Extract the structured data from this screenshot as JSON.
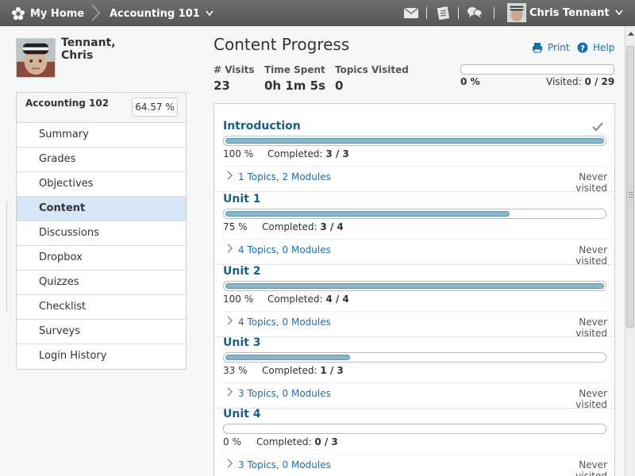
{
  "topbar": {
    "home_label": "My Home",
    "course_label": "Accounting 101",
    "user_name": "Chris Tennant",
    "icons": [
      "mail-icon",
      "notes-icon",
      "chat-icon"
    ]
  },
  "profile": {
    "name_line1": "Tennant,",
    "name_line2": "Chris"
  },
  "nav": {
    "course": "Accounting 102",
    "progress": "64.57 %",
    "items": [
      {
        "label": "Summary"
      },
      {
        "label": "Grades"
      },
      {
        "label": "Objectives"
      },
      {
        "label": "Content"
      },
      {
        "label": "Discussions"
      },
      {
        "label": "Dropbox"
      },
      {
        "label": "Quizzes"
      },
      {
        "label": "Checklist"
      },
      {
        "label": "Surveys"
      },
      {
        "label": "Login History"
      }
    ],
    "active": "Content"
  },
  "main": {
    "title": "Content Progress",
    "print_label": "Print",
    "help_label": "Help",
    "stats": {
      "visits_label": "# Visits",
      "visits_value": "23",
      "time_label": "Time Spent",
      "time_value": "0h 1m 5s",
      "topics_label": "Topics Visited",
      "topics_value": "0"
    },
    "overall": {
      "progress_fraction": 0,
      "pct_label": "0 %",
      "visited_label": "Visited:",
      "visited_value": "0 / 29"
    },
    "completed_label": "Completed:",
    "units": [
      {
        "title": "Introduction",
        "pct": "100 %",
        "progress": 1.0,
        "completed": "3 / 3",
        "link": "1 Topics, 2 Modules",
        "visit": "Never visited",
        "checked": true
      },
      {
        "title": "Unit 1",
        "pct": "75 %",
        "progress": 0.75,
        "completed": "3 / 4",
        "link": "4 Topics, 0 Modules",
        "visit": "Never visited",
        "checked": false
      },
      {
        "title": "Unit 2",
        "pct": "100 %",
        "progress": 1.0,
        "completed": "4 / 4",
        "link": "4 Topics, 0 Modules",
        "visit": "Never visited",
        "checked": false
      },
      {
        "title": "Unit 3",
        "pct": "33 %",
        "progress": 0.33,
        "completed": "1 / 3",
        "link": "3 Topics, 0 Modules",
        "visit": "Never visited",
        "checked": false
      },
      {
        "title": "Unit 4",
        "pct": "0 %",
        "progress": 0.0,
        "completed": "0 / 3",
        "link": "3 Topics, 0 Modules",
        "visit": "Never visited",
        "checked": false
      }
    ]
  },
  "colors": {
    "topbar": "#5f5f5f",
    "link": "#1b6fa8",
    "unit_title": "#1b6080",
    "progress_fill": "#86b6c8",
    "active_nav": "#d7e6f6"
  }
}
